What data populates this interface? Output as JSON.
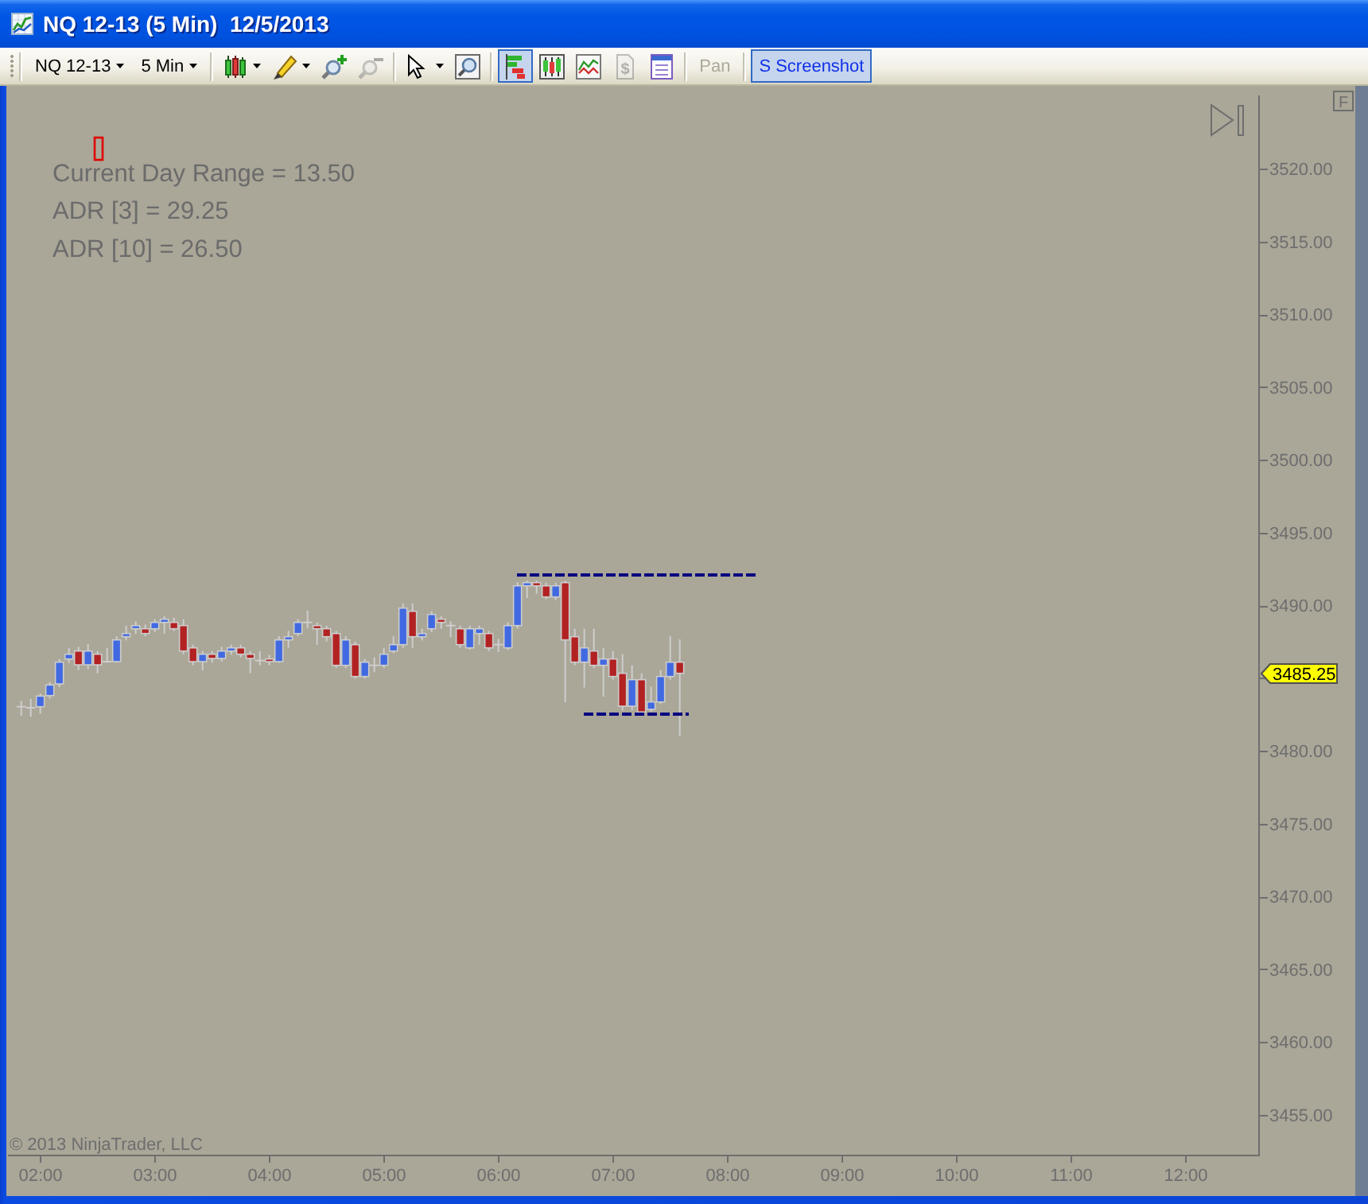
{
  "window": {
    "title": "NQ 12-13 (5 Min)  12/5/2013"
  },
  "toolbar": {
    "groups": [
      [
        {
          "kind": "text_menu",
          "label": "NQ 12-13",
          "on": false,
          "disabled": false
        },
        {
          "kind": "text_menu",
          "label": "5 Min",
          "on": false,
          "disabled": false
        }
      ],
      [
        {
          "kind": "icon_menu",
          "on": false,
          "disabled": false
        },
        {
          "kind": "icon_menu",
          "on": false,
          "disabled": false
        },
        {
          "kind": "icon",
          "on": false,
          "disabled": false
        },
        {
          "kind": "icon",
          "on": false,
          "disabled": true
        }
      ],
      [
        {
          "kind": "icon_menu",
          "on": false,
          "disabled": false
        },
        {
          "kind": "icon",
          "on": false,
          "disabled": false
        }
      ],
      [
        {
          "kind": "icon",
          "on": true,
          "disabled": false
        },
        {
          "kind": "icon",
          "on": false,
          "disabled": false
        },
        {
          "kind": "icon",
          "on": false,
          "disabled": false
        },
        {
          "kind": "icon",
          "glyph": "$",
          "on": false,
          "disabled": true
        },
        {
          "kind": "icon",
          "on": false,
          "disabled": false
        }
      ],
      [
        {
          "kind": "text",
          "label": "Pan",
          "on": false,
          "disabled": true
        }
      ],
      [
        {
          "kind": "text",
          "label": "S Screenshot",
          "on": true,
          "disabled": false
        }
      ]
    ]
  },
  "chart": {
    "stats": [
      "Current Day Range = 13.50",
      "ADR [3] = 29.25",
      "ADR [10] = 26.50"
    ],
    "f_button": "F",
    "price_axis": {
      "labels": [
        "3520.00",
        "3515.00",
        "3510.00",
        "3505.00",
        "3500.00",
        "3495.00",
        "3490.00",
        "3480.00",
        "3475.00",
        "3470.00",
        "3465.00",
        "3460.00",
        "3455.00"
      ],
      "last_price": "3485.25"
    },
    "time_axis": {
      "labels": [
        "02:00",
        "03:00",
        "04:00",
        "05:00",
        "06:00",
        "07:00",
        "08:00",
        "09:00",
        "10:00",
        "11:00",
        "12:00"
      ]
    },
    "copyright": "© 2013 NinjaTrader, LLC"
  }
}
